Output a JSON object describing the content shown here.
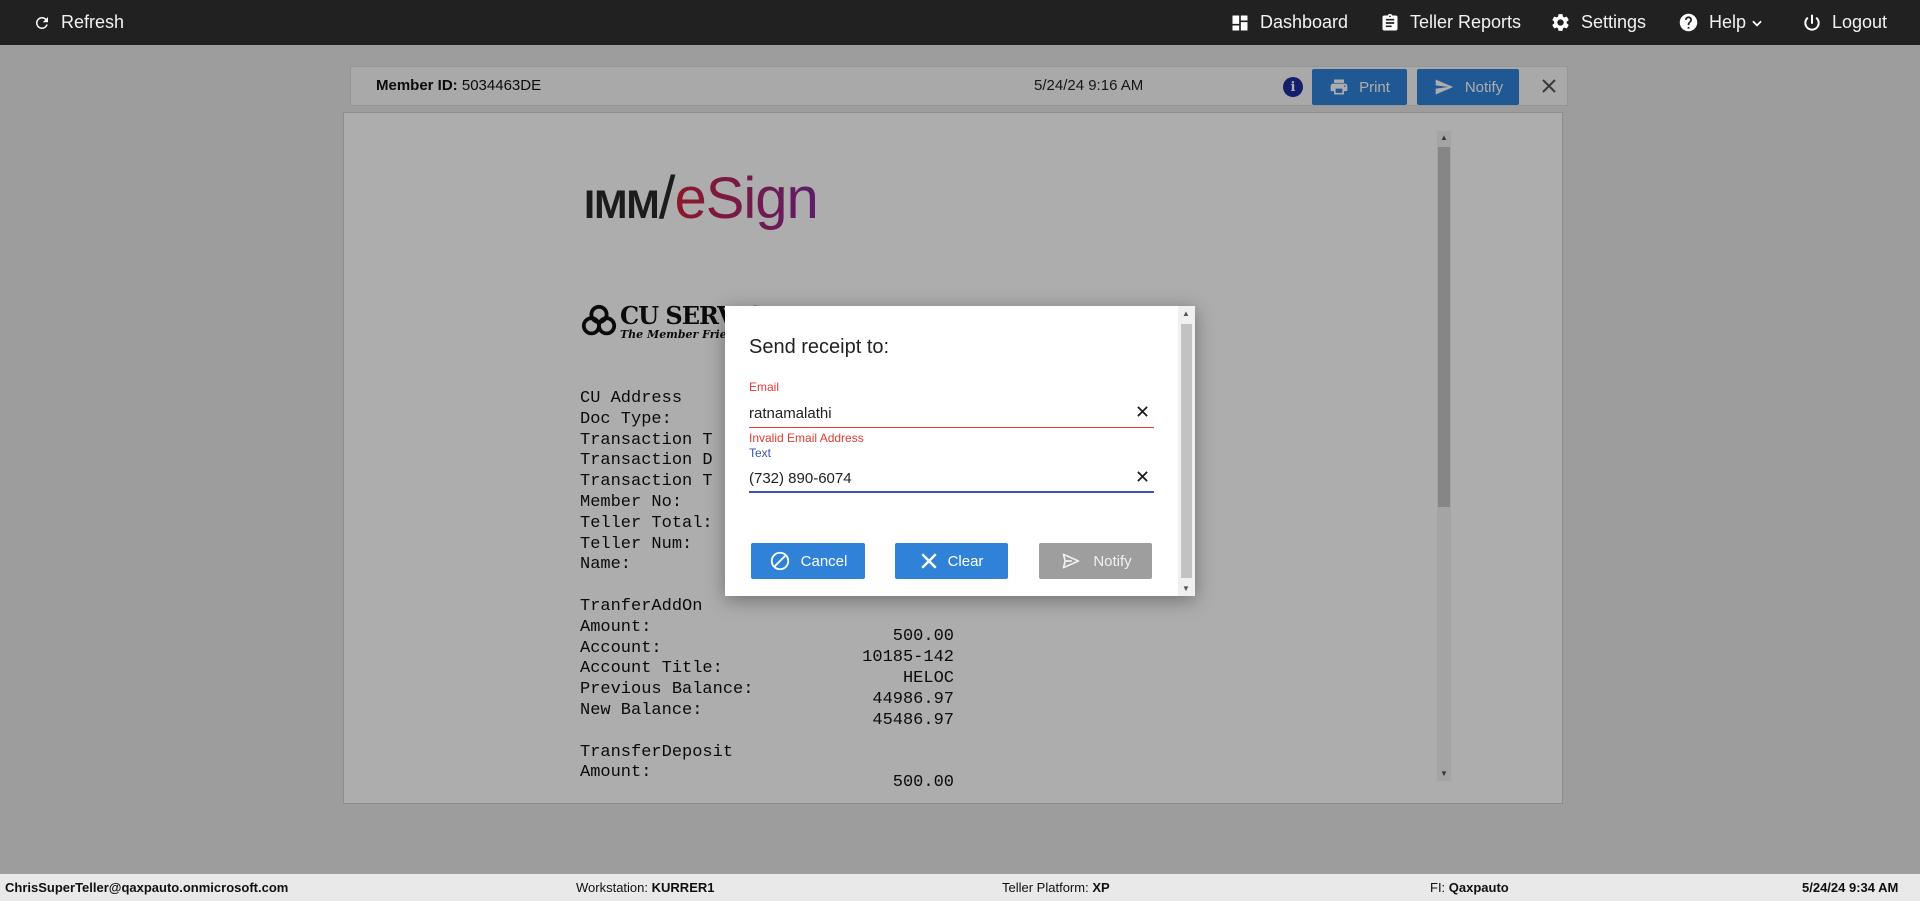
{
  "topbar": {
    "refresh_label": "Refresh",
    "nav": {
      "dashboard": "Dashboard",
      "teller_reports": "Teller Reports",
      "settings": "Settings",
      "help": "Help",
      "logout": "Logout"
    }
  },
  "header": {
    "member_id_label": "Member ID:",
    "member_id_value": "5034463DE",
    "datetime": "5/24/24 9:16 AM",
    "print_label": "Print",
    "notify_label": "Notify"
  },
  "receipt": {
    "logo_imm": "IMM",
    "logo_esign": "eSign",
    "cu_logo_line1": "CU SERVICE",
    "cu_logo_line2": "The Member Friendly",
    "lines": "CU Address\nDoc Type:\nTransaction T\nTransaction D\nTransaction T\nMember No:\nTeller Total:\nTeller Num:\nName:\n\nTranferAddOn\nAmount:\nAccount:\nAccount Title:\nPrevious Balance:\nNew Balance:\n\nTransferDeposit\nAmount:",
    "values": {
      "amount": "500.00",
      "account": "10185-142",
      "account_title": "HELOC",
      "previous_balance": "44986.97",
      "new_balance": "45486.97",
      "deposit_amount": "500.00"
    }
  },
  "modal": {
    "title": "Send receipt to:",
    "email_label": "Email",
    "email_value": "ratnamalathi",
    "email_error": "Invalid Email Address",
    "text_label": "Text",
    "text_value": "(732) 890-6074",
    "cancel_label": "Cancel",
    "clear_label": "Clear",
    "notify_label": "Notify"
  },
  "footer": {
    "user": "ChrisSuperTeller@qaxpauto.onmicrosoft.com",
    "workstation_label": "Workstation:",
    "workstation_value": "KURRER1",
    "platform_label": "Teller Platform:",
    "platform_value": "XP",
    "fi_label": "FI:",
    "fi_value": "Qaxpauto",
    "datetime": "5/24/24 9:34 AM"
  },
  "colors": {
    "primary": "#2f82d8",
    "error": "#e53935",
    "focus": "#3f51b5",
    "topbar": "#212121"
  }
}
